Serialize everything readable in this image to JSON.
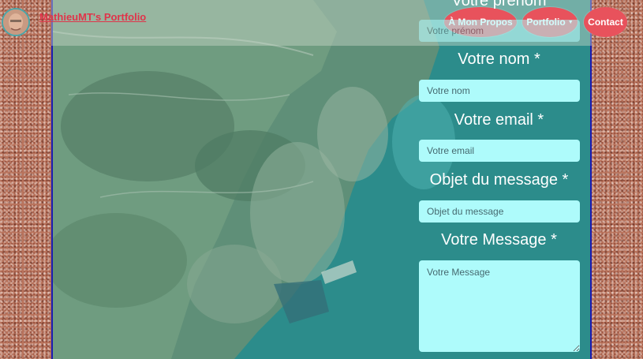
{
  "header": {
    "brand": "MathieuMT's Portfolio",
    "nav": [
      {
        "label": "À Mon Propos"
      },
      {
        "label": "Portfolio"
      },
      {
        "label": "Contact"
      }
    ]
  },
  "form": {
    "prenom_label": "Votre prénom",
    "prenom_placeholder": "Votre prénom",
    "nom_label": "Votre nom *",
    "nom_placeholder": "Votre nom",
    "email_label": "Votre email *",
    "email_placeholder": "Votre email",
    "objet_label": "Objet du message *",
    "objet_placeholder": "Objet du message",
    "message_label": "Votre Message *",
    "message_placeholder": "Votre Message"
  },
  "colors": {
    "accent": "#e8525c",
    "brand_text": "#e0344a",
    "input_bg": "#aefbfb",
    "map_border": "#1b1bb0"
  }
}
